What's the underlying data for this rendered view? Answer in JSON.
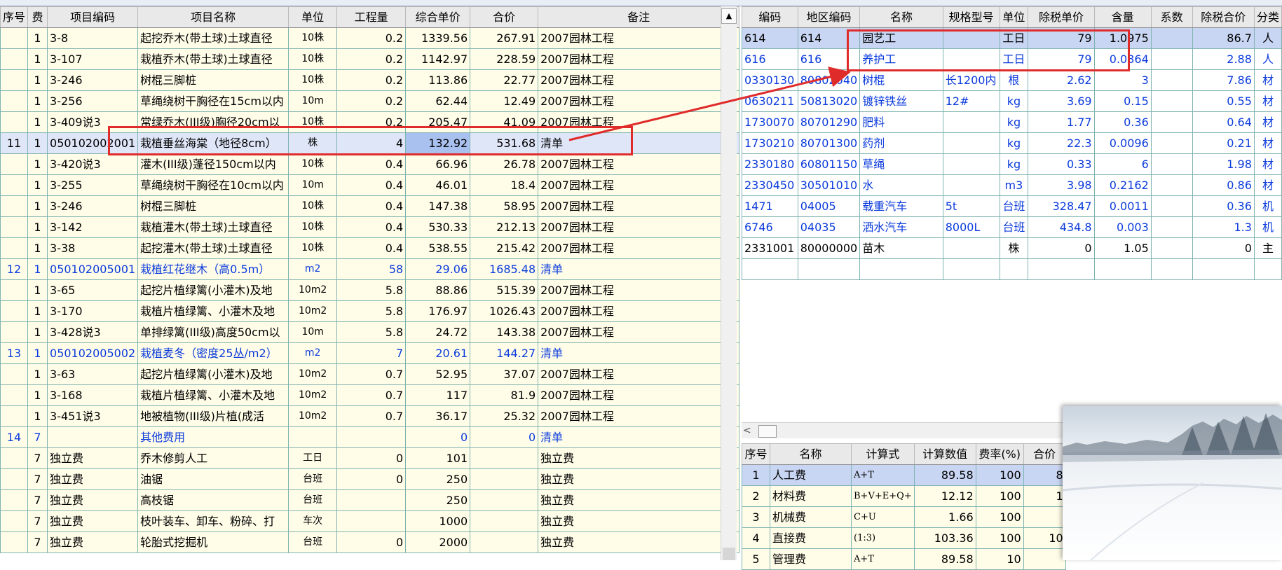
{
  "left_headers": [
    "序号",
    "费",
    "项目编码",
    "项目名称",
    "单位",
    "工程量",
    "综合单价",
    "合价",
    "备注"
  ],
  "left_rows": [
    {
      "seq": "",
      "fee": "1",
      "code": "3-8",
      "name": "起挖乔木(带土球)土球直径",
      "unit": "10株",
      "qty": "0.2",
      "price": "1339.56",
      "total": "267.91",
      "note": "2007园林工程",
      "style": ""
    },
    {
      "seq": "",
      "fee": "1",
      "code": "3-107",
      "name": "栽植乔木(带土球)土球直径",
      "unit": "10株",
      "qty": "0.2",
      "price": "1142.97",
      "total": "228.59",
      "note": "2007园林工程",
      "style": ""
    },
    {
      "seq": "",
      "fee": "1",
      "code": "3-246",
      "name": "树棍三脚桩",
      "unit": "10株",
      "qty": "0.2",
      "price": "113.86",
      "total": "22.77",
      "note": "2007园林工程",
      "style": ""
    },
    {
      "seq": "",
      "fee": "1",
      "code": "3-256",
      "name": "草绳绕树干胸径在15cm以内",
      "unit": "10m",
      "qty": "0.2",
      "price": "62.44",
      "total": "12.49",
      "note": "2007园林工程",
      "style": ""
    },
    {
      "seq": "",
      "fee": "1",
      "code": "3-409说3",
      "name": "常绿乔木(III级)胸径20cm以",
      "unit": "10株",
      "qty": "0.2",
      "price": "205.47",
      "total": "41.09",
      "note": "2007园林工程",
      "style": ""
    },
    {
      "seq": "11",
      "fee": "1",
      "code": "050102002001",
      "name": "栽植垂丝海棠（地径8cm）",
      "unit": "株",
      "qty": "4",
      "price": "132.92",
      "total": "531.68",
      "note": "清单",
      "style": "sel"
    },
    {
      "seq": "",
      "fee": "1",
      "code": "3-420说3",
      "name": "灌木(III级)蓬径150cm以内",
      "unit": "10株",
      "qty": "0.4",
      "price": "66.96",
      "total": "26.78",
      "note": "2007园林工程",
      "style": ""
    },
    {
      "seq": "",
      "fee": "1",
      "code": "3-255",
      "name": "草绳绕树干胸径在10cm以内",
      "unit": "10m",
      "qty": "0.4",
      "price": "46.01",
      "total": "18.4",
      "note": "2007园林工程",
      "style": ""
    },
    {
      "seq": "",
      "fee": "1",
      "code": "3-246",
      "name": "树棍三脚桩",
      "unit": "10株",
      "qty": "0.4",
      "price": "147.38",
      "total": "58.95",
      "note": "2007园林工程",
      "style": ""
    },
    {
      "seq": "",
      "fee": "1",
      "code": "3-142",
      "name": "栽植灌木(带土球)土球直径",
      "unit": "10株",
      "qty": "0.4",
      "price": "530.33",
      "total": "212.13",
      "note": "2007园林工程",
      "style": ""
    },
    {
      "seq": "",
      "fee": "1",
      "code": "3-38",
      "name": "起挖灌木(带土球)土球直径",
      "unit": "10株",
      "qty": "0.4",
      "price": "538.55",
      "total": "215.42",
      "note": "2007园林工程",
      "style": ""
    },
    {
      "seq": "12",
      "fee": "1",
      "code": "050102005001",
      "name": "栽植红花继木（高0.5m）",
      "unit": "m2",
      "qty": "58",
      "price": "29.06",
      "total": "1685.48",
      "note": "清单",
      "style": "blue"
    },
    {
      "seq": "",
      "fee": "1",
      "code": "3-65",
      "name": "起挖片植绿篱(小灌木)及地",
      "unit": "10m2",
      "qty": "5.8",
      "price": "88.86",
      "total": "515.39",
      "note": "2007园林工程",
      "style": ""
    },
    {
      "seq": "",
      "fee": "1",
      "code": "3-170",
      "name": "栽植片植绿篱、小灌木及地",
      "unit": "10m2",
      "qty": "5.8",
      "price": "176.97",
      "total": "1026.43",
      "note": "2007园林工程",
      "style": ""
    },
    {
      "seq": "",
      "fee": "1",
      "code": "3-428说3",
      "name": "单排绿篱(III级)高度50cm以",
      "unit": "10m",
      "qty": "5.8",
      "price": "24.72",
      "total": "143.38",
      "note": "2007园林工程",
      "style": ""
    },
    {
      "seq": "13",
      "fee": "1",
      "code": "050102005002",
      "name": "栽植麦冬（密度25丛/m2）",
      "unit": "m2",
      "qty": "7",
      "price": "20.61",
      "total": "144.27",
      "note": "清单",
      "style": "blue"
    },
    {
      "seq": "",
      "fee": "1",
      "code": "3-63",
      "name": "起挖片植绿篱(小灌木)及地",
      "unit": "10m2",
      "qty": "0.7",
      "price": "52.95",
      "total": "37.07",
      "note": "2007园林工程",
      "style": ""
    },
    {
      "seq": "",
      "fee": "1",
      "code": "3-168",
      "name": "栽植片植绿篱、小灌木及地",
      "unit": "10m2",
      "qty": "0.7",
      "price": "117",
      "total": "81.9",
      "note": "2007园林工程",
      "style": ""
    },
    {
      "seq": "",
      "fee": "1",
      "code": "3-451说3",
      "name": "地被植物(III级)片植(成活",
      "unit": "10m2",
      "qty": "0.7",
      "price": "36.17",
      "total": "25.32",
      "note": "2007园林工程",
      "style": ""
    },
    {
      "seq": "14",
      "fee": "7",
      "code": "",
      "name": "其他费用",
      "unit": "",
      "qty": "",
      "price": "0",
      "total": "0",
      "note": "清单",
      "style": "blue"
    },
    {
      "seq": "",
      "fee": "7",
      "code": "独立费",
      "name": "乔木修剪人工",
      "unit": "工日",
      "qty": "0",
      "price": "101",
      "total": "",
      "note": "独立费",
      "style": ""
    },
    {
      "seq": "",
      "fee": "7",
      "code": "独立费",
      "name": "油锯",
      "unit": "台班",
      "qty": "0",
      "price": "250",
      "total": "",
      "note": "独立费",
      "style": ""
    },
    {
      "seq": "",
      "fee": "7",
      "code": "独立费",
      "name": "高枝锯",
      "unit": "台班",
      "qty": "",
      "price": "250",
      "total": "",
      "note": "独立费",
      "style": ""
    },
    {
      "seq": "",
      "fee": "7",
      "code": "独立费",
      "name": "枝叶装车、卸车、粉碎、打",
      "unit": "车次",
      "qty": "",
      "price": "1000",
      "total": "",
      "note": "独立费",
      "style": ""
    },
    {
      "seq": "",
      "fee": "7",
      "code": "独立费",
      "name": "轮胎式挖掘机",
      "unit": "台班",
      "qty": "0",
      "price": "2000",
      "total": "",
      "note": "独立费",
      "style": ""
    }
  ],
  "right_headers": [
    "编码",
    "地区编码",
    "名称",
    "规格型号",
    "单位",
    "除税单价",
    "含量",
    "系数",
    "除税合价",
    "分类"
  ],
  "right_rows": [
    {
      "code": "614",
      "region": "614",
      "name": "园艺工",
      "spec": "",
      "unit": "工日",
      "price": "79",
      "content": "1.0975",
      "coef": "",
      "total": "86.7",
      "cat": "人",
      "style": "sel"
    },
    {
      "code": "616",
      "region": "616",
      "name": "养护工",
      "spec": "",
      "unit": "工日",
      "price": "79",
      "content": "0.0364",
      "coef": "",
      "total": "2.88",
      "cat": "人",
      "style": "blue"
    },
    {
      "code": "0330130",
      "region": "80802040",
      "name": "树棍",
      "spec": "长1200内",
      "unit": "根",
      "price": "2.62",
      "content": "3",
      "coef": "",
      "total": "7.86",
      "cat": "材",
      "style": "blue"
    },
    {
      "code": "0630211",
      "region": "50813020",
      "name": "镀锌铁丝",
      "spec": "12#",
      "unit": "kg",
      "price": "3.69",
      "content": "0.15",
      "coef": "",
      "total": "0.55",
      "cat": "材",
      "style": "blue"
    },
    {
      "code": "1730070",
      "region": "80701290",
      "name": "肥料",
      "spec": "",
      "unit": "kg",
      "price": "1.77",
      "content": "0.36",
      "coef": "",
      "total": "0.64",
      "cat": "材",
      "style": "blue"
    },
    {
      "code": "1730210",
      "region": "80701300",
      "name": "药剂",
      "spec": "",
      "unit": "kg",
      "price": "22.3",
      "content": "0.0096",
      "coef": "",
      "total": "0.21",
      "cat": "材",
      "style": "blue"
    },
    {
      "code": "2330180",
      "region": "60801150",
      "name": "草绳",
      "spec": "",
      "unit": "kg",
      "price": "0.33",
      "content": "6",
      "coef": "",
      "total": "1.98",
      "cat": "材",
      "style": "blue"
    },
    {
      "code": "2330450",
      "region": "30501010",
      "name": "水",
      "spec": "",
      "unit": "m3",
      "price": "3.98",
      "content": "0.2162",
      "coef": "",
      "total": "0.86",
      "cat": "材",
      "style": "blue"
    },
    {
      "code": "1471",
      "region": "04005",
      "name": "载重汽车",
      "spec": "5t",
      "unit": "台班",
      "price": "328.47",
      "content": "0.0011",
      "coef": "",
      "total": "0.36",
      "cat": "机",
      "style": "blue"
    },
    {
      "code": "6746",
      "region": "04035",
      "name": "洒水汽车",
      "spec": "8000L",
      "unit": "台班",
      "price": "434.8",
      "content": "0.003",
      "coef": "",
      "total": "1.3",
      "cat": "机",
      "style": "blue"
    },
    {
      "code": "2331001",
      "region": "80000000",
      "name": "苗木",
      "spec": "",
      "unit": "株",
      "price": "0",
      "content": "1.05",
      "coef": "",
      "total": "0",
      "cat": "主",
      "style": ""
    },
    {
      "code": "",
      "region": "",
      "name": "",
      "spec": "",
      "unit": "",
      "price": "",
      "content": "",
      "coef": "",
      "total": "",
      "cat": "",
      "style": ""
    }
  ],
  "fee_headers": [
    "序号",
    "名称",
    "计算式",
    "计算数值",
    "费率(%)",
    "合价"
  ],
  "fee_rows": [
    {
      "seq": "1",
      "name": "人工费",
      "formula": "A+T",
      "value": "89.58",
      "rate": "100",
      "total": "8",
      "style": "sel"
    },
    {
      "seq": "2",
      "name": "材料费",
      "formula": "B+V+E+Q+",
      "value": "12.12",
      "rate": "100",
      "total": "1",
      "style": ""
    },
    {
      "seq": "3",
      "name": "机械费",
      "formula": "C+U",
      "value": "1.66",
      "rate": "100",
      "total": "",
      "style": ""
    },
    {
      "seq": "4",
      "name": "直接费",
      "formula": "(1:3)",
      "value": "103.36",
      "rate": "100",
      "total": "10",
      "style": ""
    },
    {
      "seq": "5",
      "name": "管理费",
      "formula": "A+T",
      "value": "89.58",
      "rate": "10",
      "total": "",
      "style": ""
    }
  ],
  "scroll": {
    "up_arrow": "▲",
    "left_arrow": "<"
  },
  "colors": {
    "annotation": "#e02b2b",
    "link_blue": "#0b3bdc",
    "selected": "#dfe6f8",
    "highlight": "#a9c1ee",
    "grid_line": "#7eb3b0"
  }
}
